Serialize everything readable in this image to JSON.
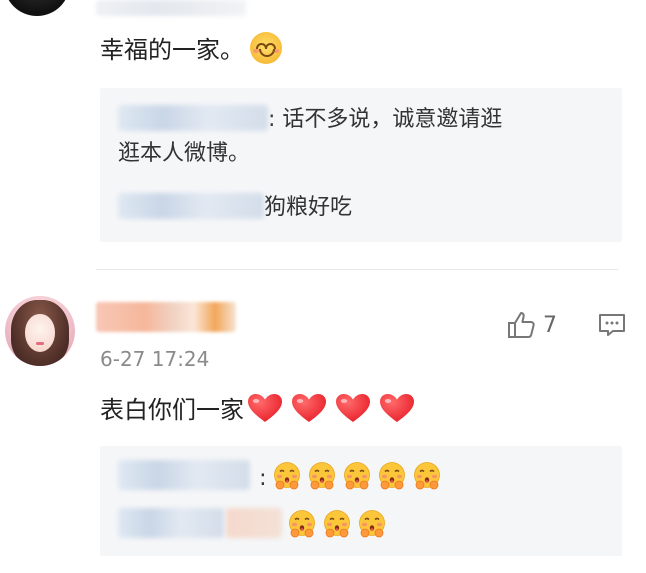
{
  "comment1": {
    "text": "幸福的一家。",
    "emoji": "smiling-face-icon"
  },
  "reply_box1": {
    "line1_rest": ": 话不多说，诚意邀请逛",
    "line2": "逛本人微博。",
    "line3_rest": "狗粮好吃"
  },
  "comment2": {
    "timestamp": "6-27 17:24",
    "text": "表白你们一家",
    "hearts": 4,
    "likes": "7"
  },
  "reply_box2": {
    "line1_sep": ":"
  },
  "colors": {
    "heart": "#e8202b",
    "reply_bg": "#f5f6f8",
    "timestamp": "#8a8a8a",
    "divider": "#e8e8e8"
  }
}
